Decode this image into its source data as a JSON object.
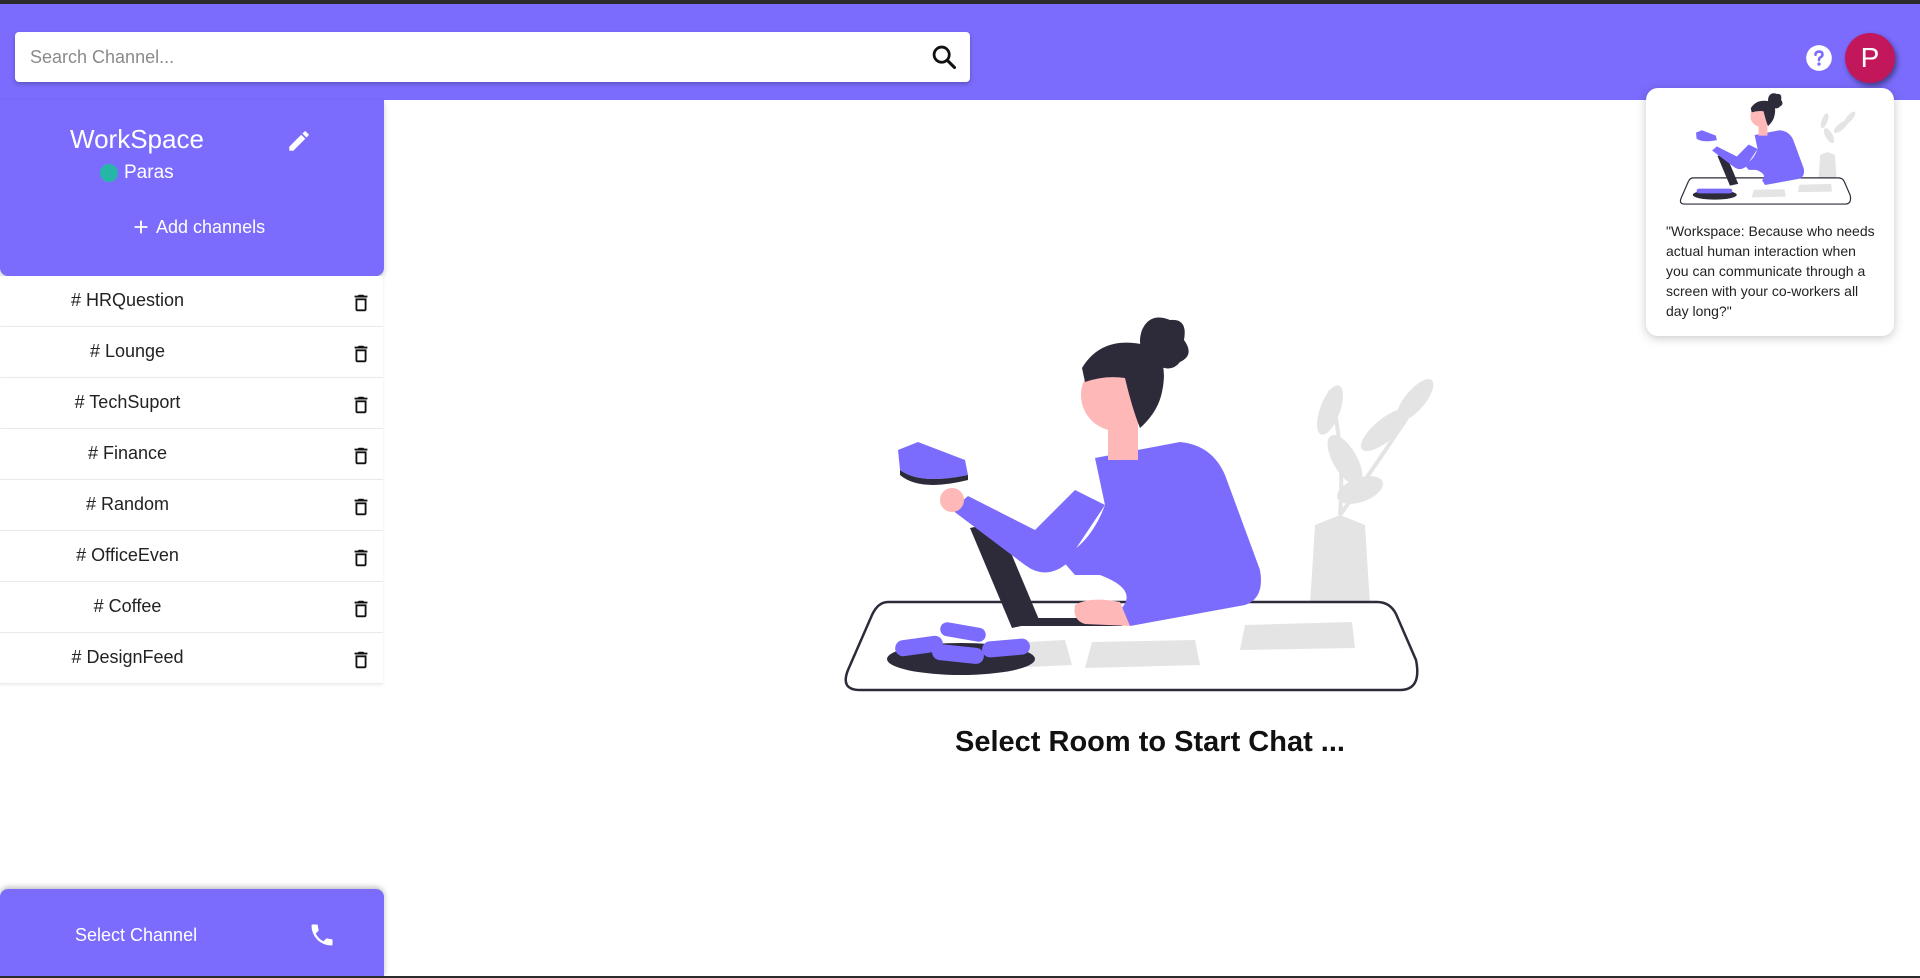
{
  "search": {
    "placeholder": "Search Channel..."
  },
  "header": {
    "avatar_initial": "P"
  },
  "workspace": {
    "title": "WorkSpace",
    "user": "Paras",
    "add_label": "Add channels"
  },
  "channels": [
    {
      "label": "# HRQuestion"
    },
    {
      "label": "# Lounge"
    },
    {
      "label": "# TechSuport"
    },
    {
      "label": "# Finance"
    },
    {
      "label": "# Random"
    },
    {
      "label": "# OfficeEven"
    },
    {
      "label": "# Coffee"
    },
    {
      "label": "# DesignFeed"
    }
  ],
  "footer": {
    "label": "Select Channel"
  },
  "main": {
    "empty_message": "Select Room to Start Chat ..."
  },
  "tip": {
    "text": "\"Workspace: Because who needs actual human interaction when you can communicate through a screen with your co-workers all day long?\""
  },
  "colors": {
    "brand": "#7b6cfd",
    "avatar": "#c2185b",
    "online": "#26b6a8"
  },
  "icons": {
    "search": "search-icon",
    "help": "help-icon",
    "edit": "pencil-icon",
    "add": "plus-icon",
    "delete": "trash-icon",
    "phone": "phone-icon"
  }
}
